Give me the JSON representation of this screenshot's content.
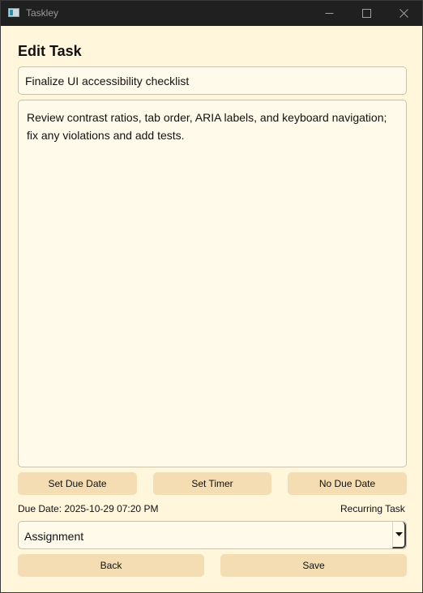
{
  "window": {
    "title": "Taskley"
  },
  "form": {
    "heading": "Edit Task",
    "title_value": "Finalize UI accessibility checklist",
    "description_value": "Review contrast ratios, tab order, ARIA labels, and keyboard navigation; fix any violations and add tests."
  },
  "due_buttons": {
    "set_due_date": "Set Due Date",
    "set_timer": "Set Timer",
    "no_due_date": "No Due Date"
  },
  "status": {
    "due_date": "Due Date: 2025-10-29 07:20 PM",
    "recurring": "Recurring Task"
  },
  "category": {
    "selected": "Assignment"
  },
  "actions": {
    "back": "Back",
    "save": "Save"
  },
  "colors": {
    "window_background": "#fff6dc",
    "button_background": "#f4ddb2",
    "titlebar": "#202020"
  },
  "icons": {
    "minimize": "minimize-icon",
    "maximize": "maximize-icon",
    "close": "close-icon",
    "dropdown": "dropdown-arrow-icon"
  }
}
